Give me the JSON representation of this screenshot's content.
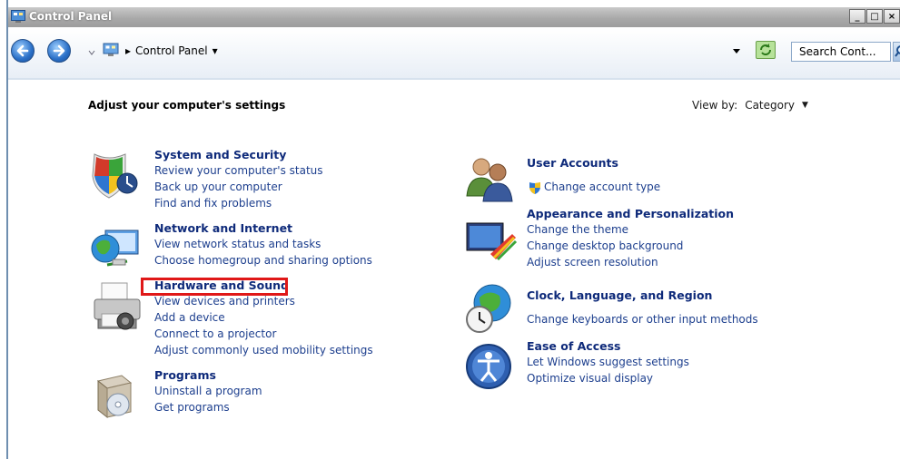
{
  "window": {
    "title": "Control Panel",
    "caption_buttons": [
      "_",
      "□",
      "×"
    ]
  },
  "address_bar": {
    "breadcrumb_separator": "▸",
    "breadcrumb": "Control Panel",
    "breadcrumb_arrow": "▾",
    "search_placeholder": "Search Cont..."
  },
  "content": {
    "heading": "Adjust your computer's settings",
    "view_by_label": "View by:",
    "view_by_value": "Category",
    "view_by_arrow": "▼"
  },
  "categories_left": [
    {
      "title": "System and Security",
      "links": [
        "Review your computer's status",
        "Back up your computer",
        "Find and fix problems"
      ]
    },
    {
      "title": "Network and Internet",
      "links": [
        "View network status and tasks",
        "Choose homegroup and sharing options"
      ]
    },
    {
      "title": "Hardware and Sound",
      "links": [
        "View devices and printers",
        "Add a device",
        "Connect to a projector",
        "Adjust commonly used mobility settings"
      ]
    },
    {
      "title": "Programs",
      "links": [
        "Uninstall a program",
        "Get programs"
      ]
    }
  ],
  "categories_right": [
    {
      "title": "User Accounts",
      "links": [
        "Change account type"
      ]
    },
    {
      "title": "Appearance and Personalization",
      "links": [
        "Change the theme",
        "Change desktop background",
        "Adjust screen resolution"
      ]
    },
    {
      "title": "Clock, Language, and Region",
      "links": [
        "Change keyboards or other input methods"
      ]
    },
    {
      "title": "Ease of Access",
      "links": [
        "Let Windows suggest settings",
        "Optimize visual display"
      ]
    }
  ],
  "highlight_color": "#e01818"
}
